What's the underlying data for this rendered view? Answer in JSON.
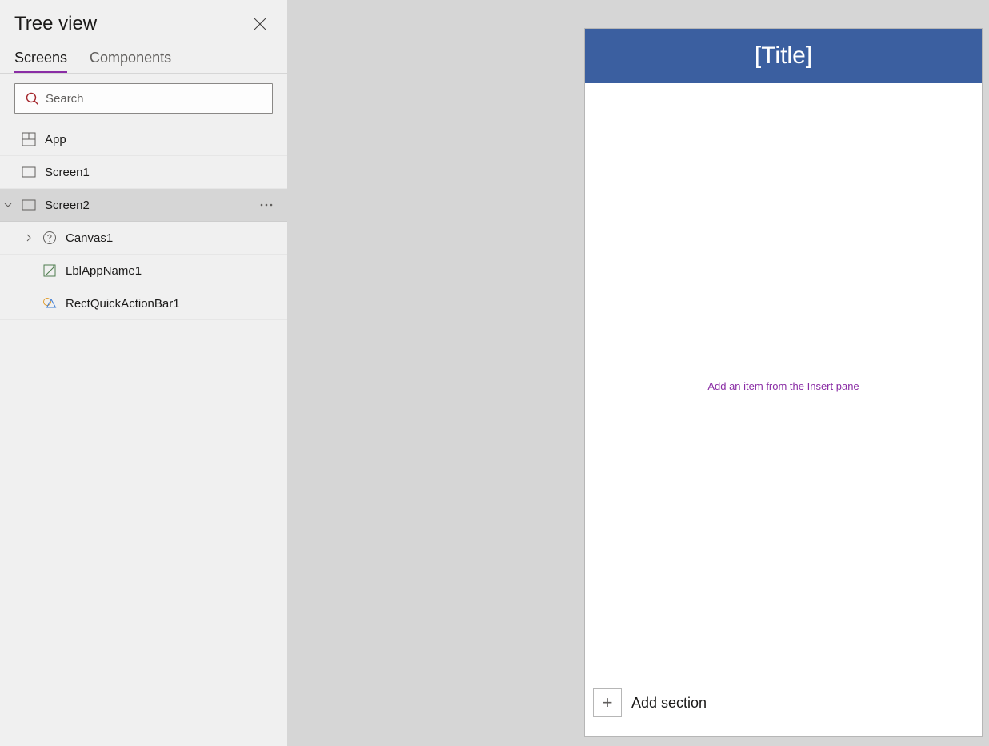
{
  "treeView": {
    "title": "Tree view",
    "tabs": {
      "screens": "Screens",
      "components": "Components"
    },
    "search": {
      "placeholder": "Search"
    },
    "nodes": {
      "app": {
        "label": "App"
      },
      "screen1": {
        "label": "Screen1"
      },
      "screen2": {
        "label": "Screen2"
      },
      "canvas1": {
        "label": "Canvas1"
      },
      "lblApp": {
        "label": "LblAppName1"
      },
      "rectBar": {
        "label": "RectQuickActionBar1"
      }
    }
  },
  "canvas": {
    "title": "[Title]",
    "placeholder": "Add an item from the Insert pane",
    "addSection": "Add section"
  }
}
